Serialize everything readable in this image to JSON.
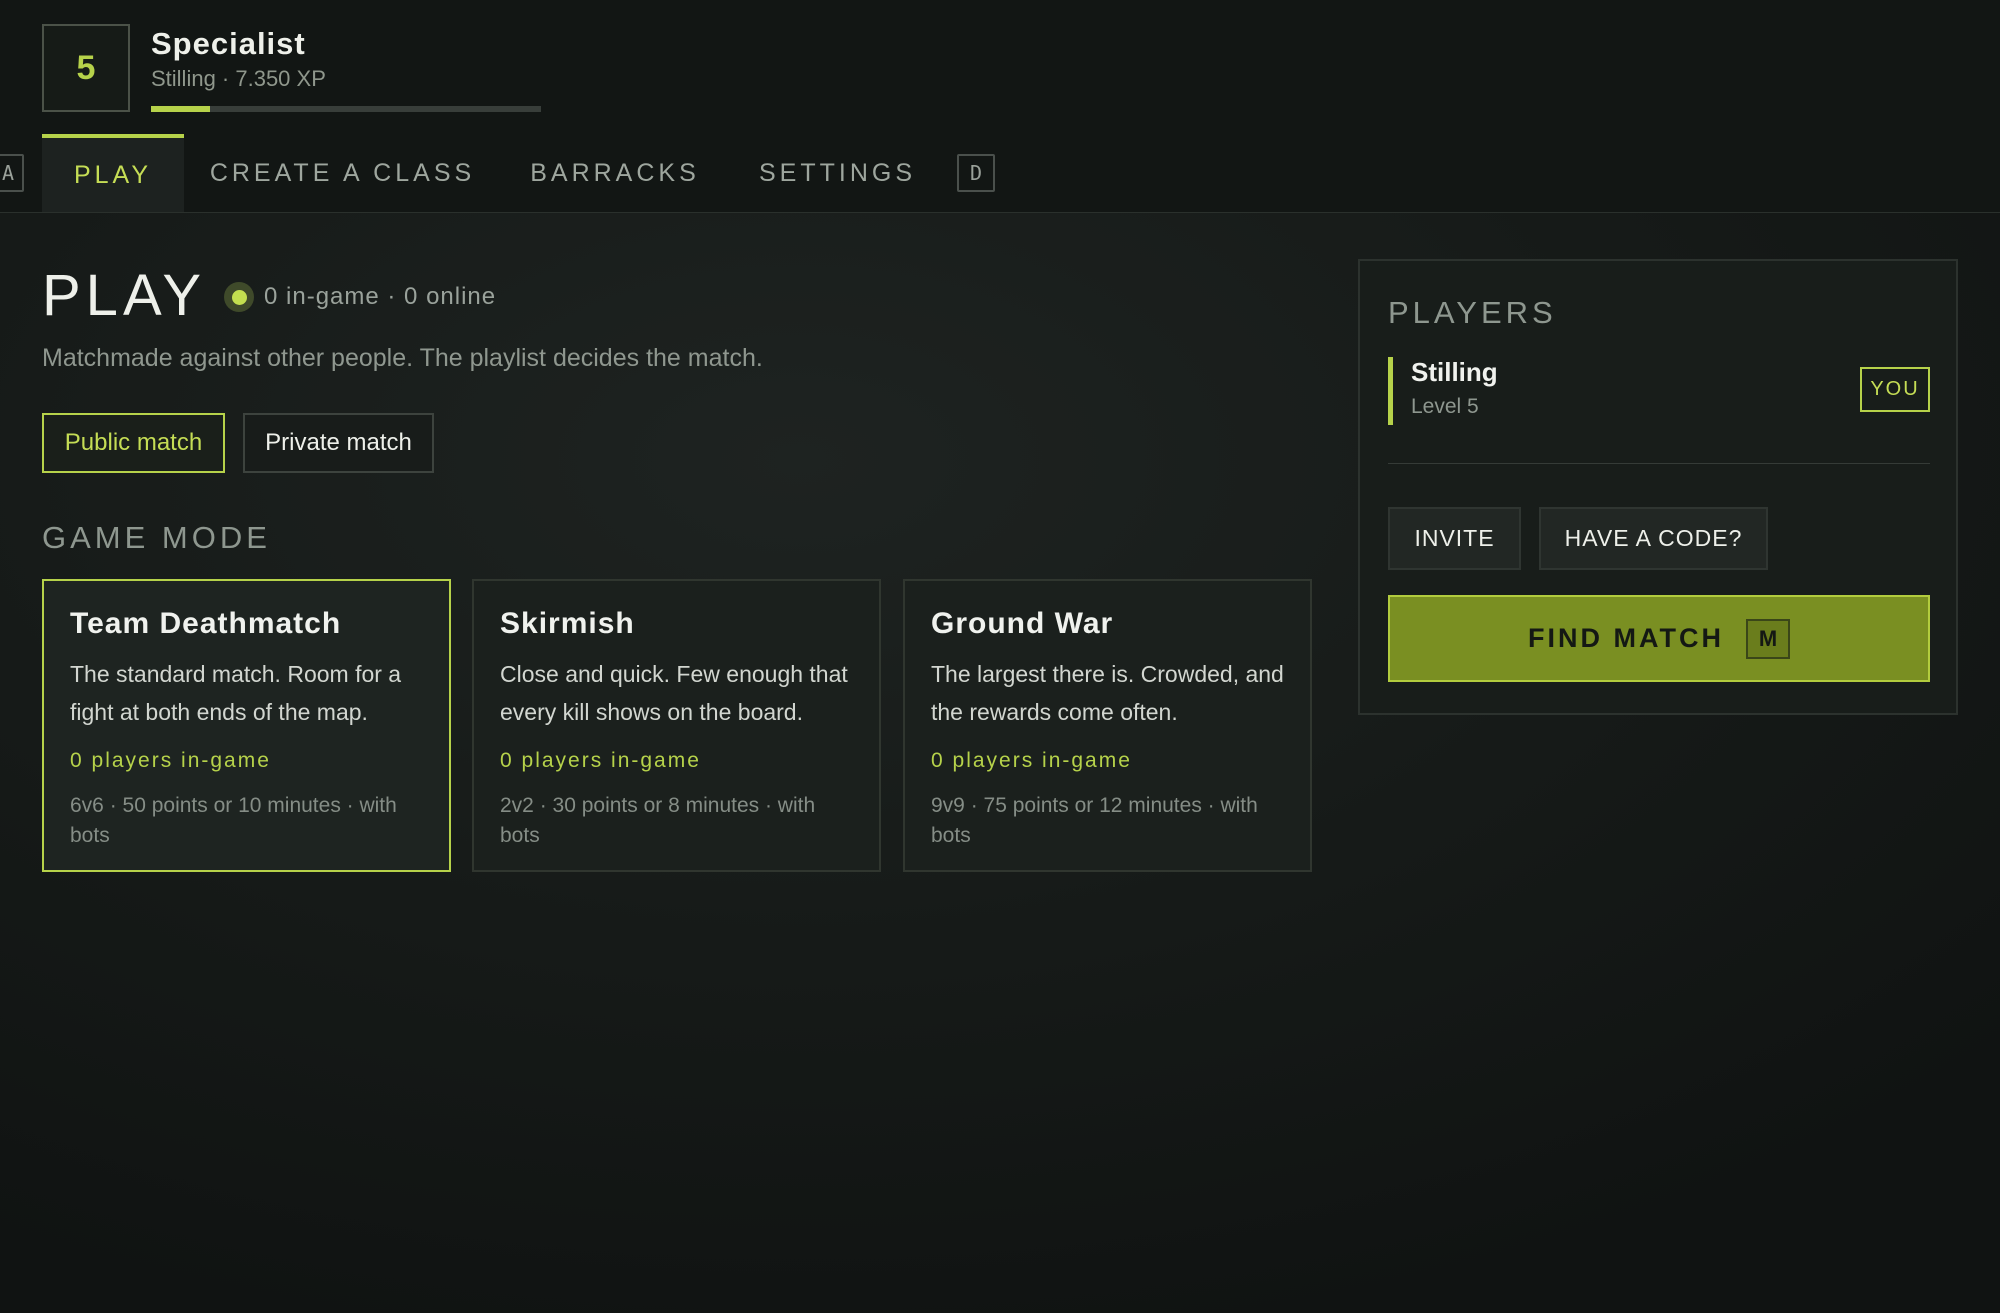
{
  "profile": {
    "level": "5",
    "rank_title": "Specialist",
    "subtitle": "Stilling · 7.350 XP",
    "xp_progress": 0.15
  },
  "nav": {
    "prev_key": "A",
    "next_key": "D",
    "tabs": [
      {
        "label": "PLAY",
        "active": true
      },
      {
        "label": "CREATE A CLASS",
        "active": false
      },
      {
        "label": "BARRACKS",
        "active": false
      },
      {
        "label": "SETTINGS",
        "active": false
      }
    ]
  },
  "main": {
    "title": "PLAY",
    "online_status": "0 in-game · 0 online",
    "description": "Matchmade against other people. The playlist decides the match.",
    "match_types": {
      "public": "Public match",
      "private": "Private match",
      "selected": "public"
    },
    "section_label": "GAME MODE",
    "modes": [
      {
        "name": "Team Deathmatch",
        "description": "The standard match. Room for a fight at both ends of the map.",
        "players": "0 players in-game",
        "meta": "6v6 · 50 points or 10 minutes · with bots",
        "selected": true
      },
      {
        "name": "Skirmish",
        "description": "Close and quick. Few enough that every kill shows on the board.",
        "players": "0 players in-game",
        "meta": "2v2 · 30 points or 8 minutes · with bots",
        "selected": false
      },
      {
        "name": "Ground War",
        "description": "The largest there is. Crowded, and the rewards come often.",
        "players": "0 players in-game",
        "meta": "9v9 · 75 points or 12 minutes · with bots",
        "selected": false
      }
    ]
  },
  "players_panel": {
    "title": "PLAYERS",
    "players": [
      {
        "name": "Stilling",
        "level": "Level 5",
        "badge": "YOU"
      }
    ],
    "invite_label": "INVITE",
    "code_label": "HAVE A CODE?",
    "find_match_label": "FIND MATCH",
    "find_match_key": "M"
  },
  "colors": {
    "accent": "#b6d24a",
    "find_match_bg": "#7a8f22",
    "background": "#141816"
  }
}
